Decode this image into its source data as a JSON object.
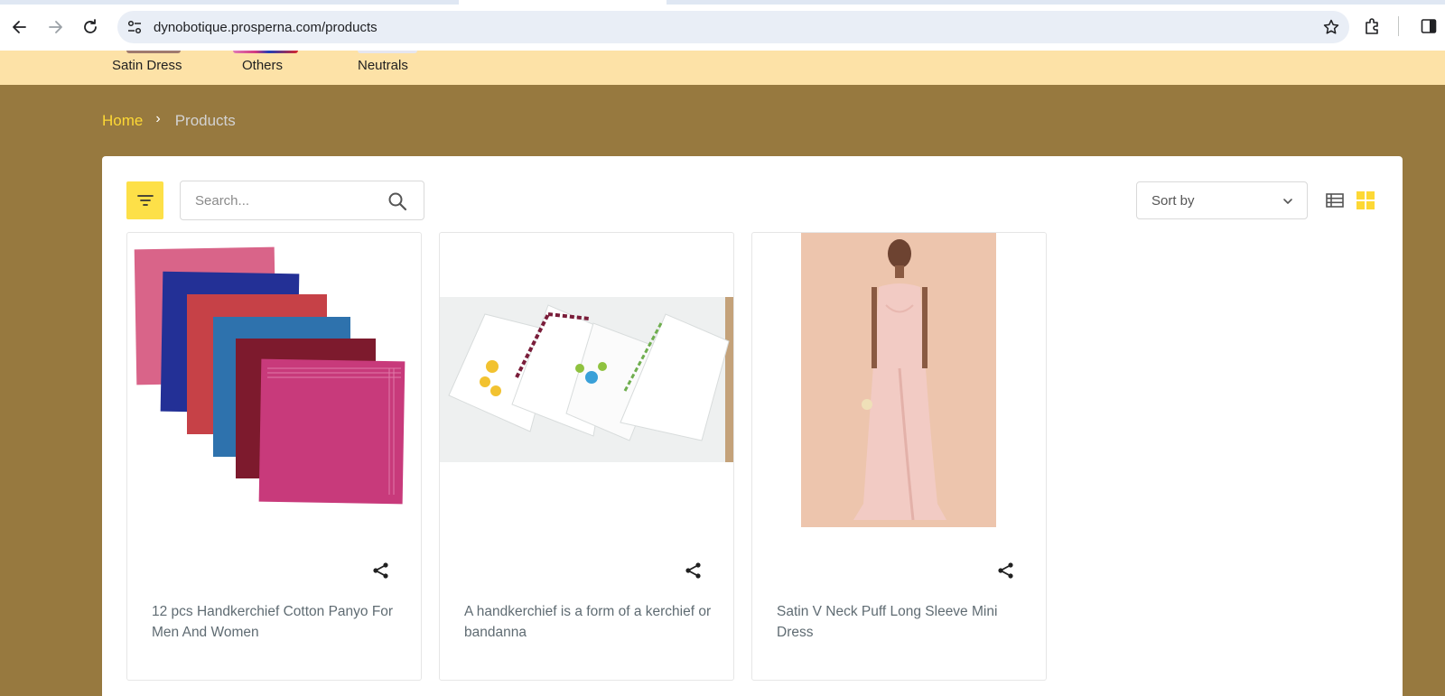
{
  "browser": {
    "url": "dynobotique.prosperna.com/products"
  },
  "categories": [
    {
      "label": "Satin Dress"
    },
    {
      "label": "Others"
    },
    {
      "label": "Neutrals"
    }
  ],
  "breadcrumb": {
    "home": "Home",
    "separator": "›",
    "current": "Products"
  },
  "toolbar": {
    "search_placeholder": "Search...",
    "sort_label": "Sort by"
  },
  "products": [
    {
      "title": "12 pcs Handkerchief Cotton Panyo For Men And Women",
      "image": "stacked colored handkerchiefs"
    },
    {
      "title": "A handkerchief is a form of a kerchief or bandanna",
      "image": "embroidered white handkerchiefs"
    },
    {
      "title": "Satin V Neck Puff Long Sleeve Mini Dress",
      "image": "pink satin dress"
    }
  ],
  "colors": {
    "page_bg": "#97793f",
    "category_bar": "#fde2a7",
    "accent_yellow": "#fde048",
    "breadcrumb_home": "#fdd835"
  }
}
